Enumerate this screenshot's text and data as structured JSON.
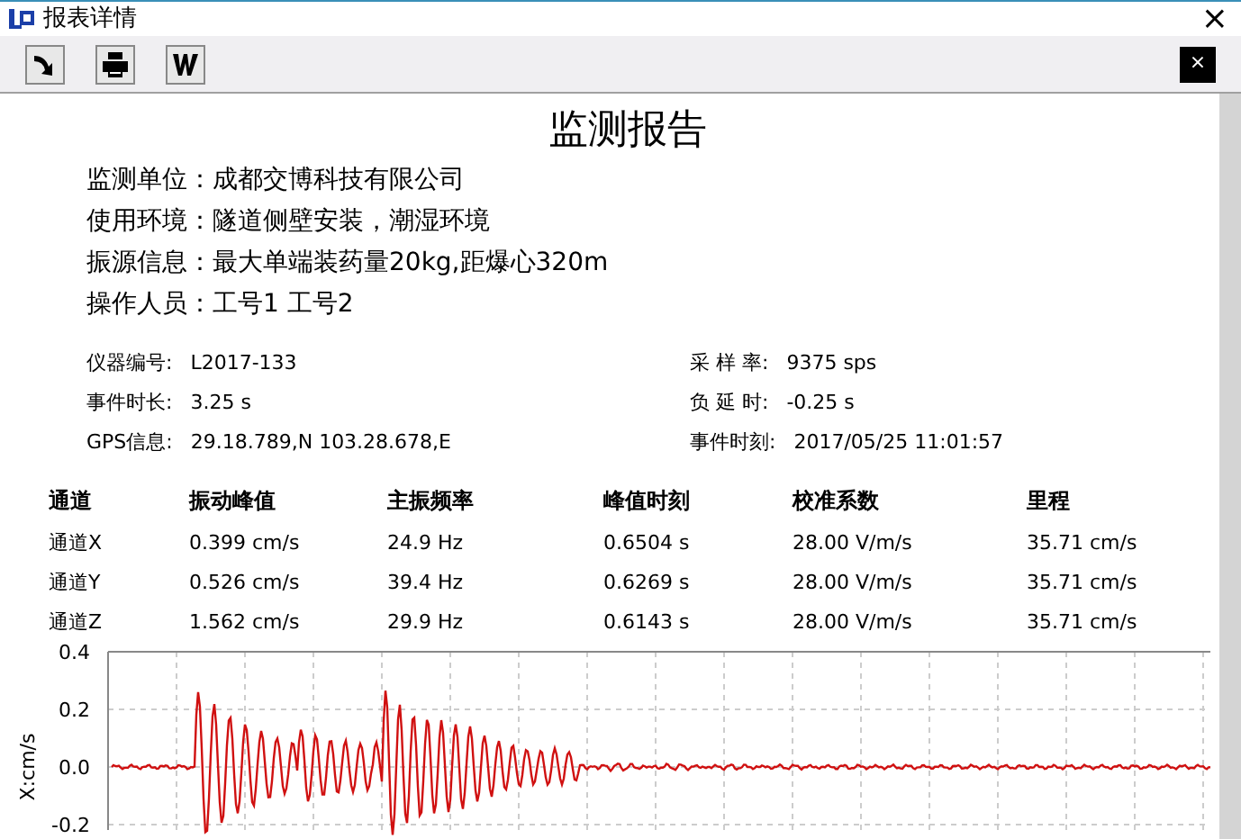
{
  "window": {
    "title": "报表详情",
    "close": "×"
  },
  "toolbar": {
    "close": "×"
  },
  "report": {
    "title": "监测报告",
    "info": [
      {
        "label": "监测单位：",
        "value": "成都交博科技有限公司"
      },
      {
        "label": "使用环境：",
        "value": "隧道侧壁安装，潮湿环境"
      },
      {
        "label": "振源信息：",
        "value": "最大单端装药量20kg,距爆心320m"
      },
      {
        "label": "操作人员：",
        "value": "工号1 工号2"
      }
    ],
    "params": [
      {
        "label": "仪器编号:",
        "value": "L2017-133"
      },
      {
        "label": "采 样 率:",
        "value": "9375 sps"
      },
      {
        "label": "事件时长:",
        "value": "3.25 s"
      },
      {
        "label": "负 延 时:",
        "value": "-0.25 s"
      },
      {
        "label": "GPS信息:",
        "value": "29.18.789,N 103.28.678,E"
      },
      {
        "label": "事件时刻:",
        "value": "2017/05/25 11:01:57"
      }
    ]
  },
  "table": {
    "columns": [
      "通道",
      "振动峰值",
      "主振频率",
      "峰值时刻",
      "校准系数",
      "里程"
    ],
    "rows": [
      [
        "通道X",
        "0.399 cm/s",
        "24.9 Hz",
        "0.6504 s",
        "28.00 V/m/s",
        "35.71 cm/s"
      ],
      [
        "通道Y",
        "0.526 cm/s",
        "39.4 Hz",
        "0.6269 s",
        "28.00 V/m/s",
        "35.71 cm/s"
      ],
      [
        "通道Z",
        "1.562 cm/s",
        "29.9 Hz",
        "0.6143 s",
        "28.00 V/m/s",
        "35.71 cm/s"
      ]
    ]
  },
  "waveform": {
    "ylabel": "X:cm/s",
    "yticks": [
      "0.4",
      "0.2",
      "0.0",
      "-0.2"
    ]
  }
}
